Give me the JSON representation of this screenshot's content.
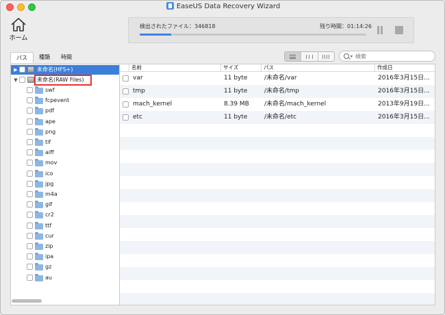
{
  "window": {
    "title": "EaseUS Data Recovery Wizard"
  },
  "toolbar": {
    "home_label": "ホーム",
    "found_files": "検出されたファイル：346818",
    "time_remaining": "残り時間：01:14:26",
    "progress_fraction": 0.14
  },
  "tabs": [
    {
      "label": "パス",
      "active": true
    },
    {
      "label": "種類",
      "active": false
    },
    {
      "label": "時間",
      "active": false
    }
  ],
  "view_modes": [
    "list-view-icon",
    "column-view-icon",
    "tile-view-icon"
  ],
  "search": {
    "placeholder": "検索",
    "value": ""
  },
  "tree": {
    "drives": [
      {
        "label": "未命名(HFS+)",
        "selected": true,
        "expanded": false
      },
      {
        "label": "未命名(RAW Files)",
        "selected": false,
        "expanded": true,
        "highlighted": true
      }
    ],
    "folders": [
      "swf",
      "fcpevent",
      "pdf",
      "ape",
      "png",
      "tif",
      "aiff",
      "mov",
      "ico",
      "jpg",
      "m4a",
      "gif",
      "cr2",
      "ttf",
      "cur",
      "zip",
      "ipa",
      "gz",
      "au"
    ]
  },
  "file_list": {
    "columns": {
      "name": "名前",
      "size": "サイズ",
      "path": "パス",
      "created": "作成日"
    },
    "rows": [
      {
        "name": "var",
        "size": "11 byte",
        "path": "/未命名/var",
        "created": "2016年3月15日..."
      },
      {
        "name": "tmp",
        "size": "11 byte",
        "path": "/未命名/tmp",
        "created": "2016年3月15日..."
      },
      {
        "name": "mach_kernel",
        "size": "8.39 MB",
        "path": "/未命名/mach_kernel",
        "created": "2013年9月19日..."
      },
      {
        "name": "etc",
        "size": "11 byte",
        "path": "/未命名/etc",
        "created": "2016年3月15日..."
      }
    ]
  },
  "colors": {
    "selection": "#3c7fd9",
    "progress": "#3b82e5",
    "highlight_box": "#e5322d"
  }
}
